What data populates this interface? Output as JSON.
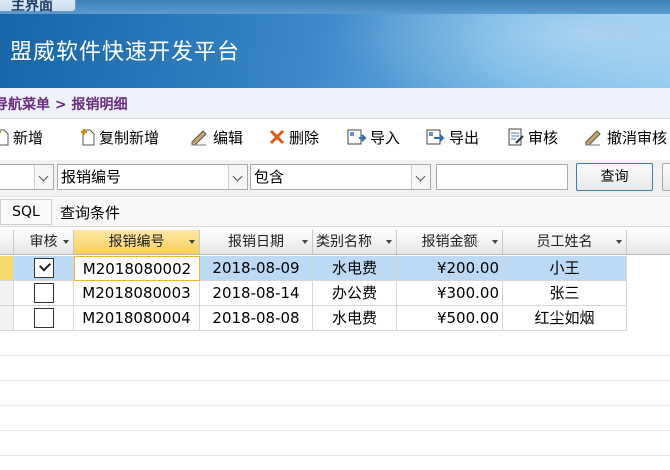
{
  "window": {
    "tab_label": "主界面"
  },
  "banner": {
    "title": "盟威软件快速开发平台"
  },
  "breadcrumb": {
    "text": "导航菜单 > 报销明细"
  },
  "toolbar": {
    "add": "新增",
    "copy_add": "复制新增",
    "edit": "编辑",
    "delete": "删除",
    "import": "导入",
    "export": "导出",
    "audit": "审核",
    "unaudit": "撤消审核"
  },
  "filter": {
    "field_value": "报销编号",
    "operator_value": "包含",
    "keyword_value": "",
    "query_button": "查询"
  },
  "sql_row": {
    "tab_label": "SQL",
    "condition_label": "查询条件"
  },
  "grid": {
    "headers": [
      "审核",
      "报销编号",
      "报销日期",
      "类别名称",
      "报销金额",
      "员工姓名"
    ],
    "rows": [
      {
        "audited": true,
        "code": "M2018080002",
        "date": "2018-08-09",
        "category": "水电费",
        "amount": "¥200.00",
        "employee": "小王"
      },
      {
        "audited": false,
        "code": "M2018080003",
        "date": "2018-08-14",
        "category": "办公费",
        "amount": "¥300.00",
        "employee": "张三"
      },
      {
        "audited": false,
        "code": "M2018080004",
        "date": "2018-08-08",
        "category": "水电费",
        "amount": "¥500.00",
        "employee": "红尘如烟"
      }
    ]
  }
}
